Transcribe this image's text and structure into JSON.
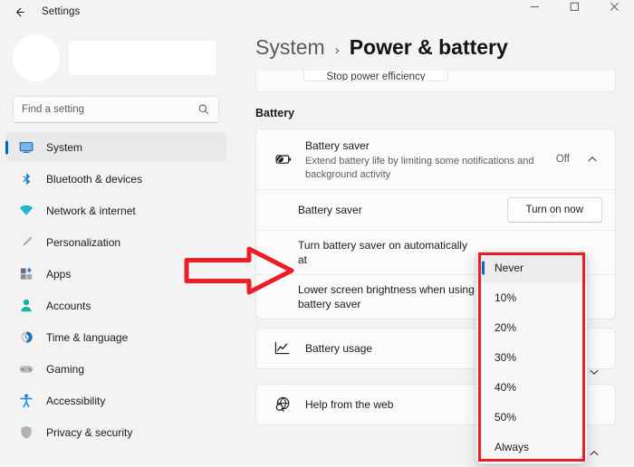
{
  "window": {
    "app_title": "Settings",
    "back_icon": "back-arrow-icon",
    "minimize_label": "Minimize",
    "maximize_label": "Maximize",
    "close_label": "Close"
  },
  "sidebar": {
    "account": {
      "avatar_label": "",
      "name": ""
    },
    "search": {
      "placeholder": "Find a setting",
      "value": "",
      "icon": "search-icon"
    },
    "items": [
      {
        "label": "System",
        "icon": "display-icon",
        "selected": true
      },
      {
        "label": "Bluetooth & devices",
        "icon": "bluetooth-icon",
        "selected": false
      },
      {
        "label": "Network & internet",
        "icon": "wifi-icon",
        "selected": false
      },
      {
        "label": "Personalization",
        "icon": "paintbrush-icon",
        "selected": false
      },
      {
        "label": "Apps",
        "icon": "apps-icon",
        "selected": false
      },
      {
        "label": "Accounts",
        "icon": "person-icon",
        "selected": false
      },
      {
        "label": "Time & language",
        "icon": "clock-icon",
        "selected": false
      },
      {
        "label": "Gaming",
        "icon": "gamepad-icon",
        "selected": false
      },
      {
        "label": "Accessibility",
        "icon": "accessibility-icon",
        "selected": false
      },
      {
        "label": "Privacy & security",
        "icon": "shield-icon",
        "selected": false
      }
    ]
  },
  "breadcrumb": {
    "parent": "System",
    "separator": "›",
    "current": "Power & battery"
  },
  "main": {
    "clipped_card": {
      "button_label": "Stop power efficiency"
    },
    "battery_section": {
      "title": "Battery",
      "battery_saver": {
        "icon": "battery-saver-icon",
        "title": "Battery saver",
        "description": "Extend battery life by limiting some notifications and background activity",
        "value": "Off",
        "expand_icon": "chevron-up-icon"
      },
      "turn_on_row": {
        "label": "Battery saver",
        "button_label": "Turn on now"
      },
      "auto_on_row": {
        "label": "Turn battery saver on automatically at",
        "selected_value": "Never"
      },
      "lower_brightness_row": {
        "label": "Lower screen brightness when using battery saver"
      },
      "battery_usage": {
        "icon": "line-chart-icon",
        "title": "Battery usage",
        "expand_icon": "chevron-down-icon"
      }
    },
    "help_row": {
      "icon": "web-help-icon",
      "title": "Help from the web",
      "expand_icon": "chevron-up-icon"
    }
  },
  "dropdown": {
    "options": [
      {
        "label": "Never",
        "selected": true
      },
      {
        "label": "10%",
        "selected": false
      },
      {
        "label": "20%",
        "selected": false
      },
      {
        "label": "30%",
        "selected": false
      },
      {
        "label": "40%",
        "selected": false
      },
      {
        "label": "50%",
        "selected": false
      },
      {
        "label": "Always",
        "selected": false
      }
    ]
  },
  "annotations": {
    "color": "#ee1c25",
    "arrow": "red-right-arrow",
    "highlight_box": "red-rectangle-around-dropdown"
  }
}
